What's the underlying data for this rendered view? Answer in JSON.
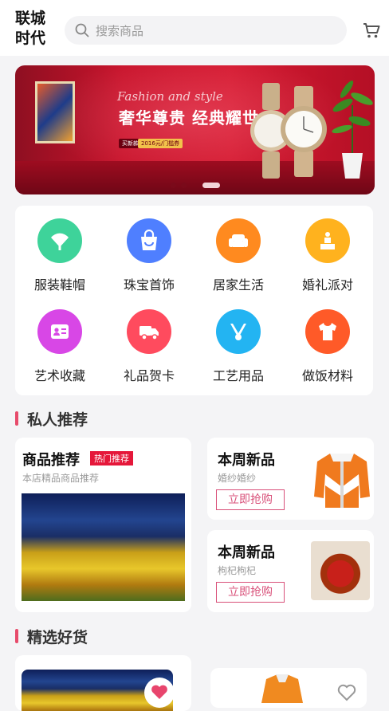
{
  "app": {
    "logo_text": "联城\n时代"
  },
  "search": {
    "placeholder": "搜索商品"
  },
  "banner": {
    "script_text": "Fashion and style",
    "headline": "奢华尊贵 经典耀世",
    "tag_left": "买新款",
    "tag_right": "2016元/门槛券",
    "slide_count": 3,
    "active_slide": 3
  },
  "categories": [
    {
      "label": "服装鞋帽",
      "icon": "fan-icon",
      "color": "#3ed39a"
    },
    {
      "label": "珠宝首饰",
      "icon": "shopping-bag-icon",
      "color": "#4f7fff"
    },
    {
      "label": "居家生活",
      "icon": "sofa-icon",
      "color": "#ff8a1f"
    },
    {
      "label": "婚礼派对",
      "icon": "cake-icon",
      "color": "#ffb21e"
    },
    {
      "label": "艺术收藏",
      "icon": "id-card-icon",
      "color": "#d847e6"
    },
    {
      "label": "礼品贺卡",
      "icon": "delivery-truck-icon",
      "color": "#ff4b5e"
    },
    {
      "label": "工艺用品",
      "icon": "necklace-icon",
      "color": "#23b4f2"
    },
    {
      "label": "做饭材料",
      "icon": "t-shirt-icon",
      "color": "#ff5a28"
    }
  ],
  "sections": {
    "personal": "私人推荐",
    "featured": "精选好货"
  },
  "recommend": {
    "main": {
      "title": "商品推荐",
      "badge": "热门推荐",
      "subtitle": "本店精品商品推荐"
    },
    "weekly": [
      {
        "title": "本周新品",
        "subtitle": "婚纱婚纱",
        "button": "立即抢购"
      },
      {
        "title": "本周新品",
        "subtitle": "枸杞枸杞",
        "button": "立即抢购"
      }
    ]
  }
}
